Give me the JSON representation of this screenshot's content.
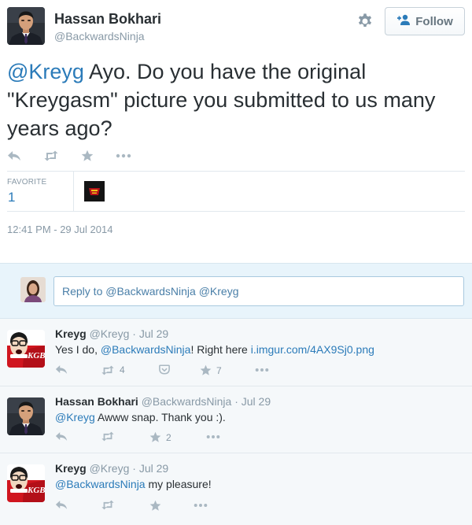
{
  "main_tweet": {
    "author_name": "Hassan Bokhari",
    "author_handle": "@BackwardsNinja",
    "follow_label": "Follow",
    "text_mention": "@Kreyg",
    "text_body": " Ayo. Do you have the original \"Kreygasm\" picture you submitted to us many years ago?",
    "favorite_label": "FAVORITE",
    "favorite_count": "1",
    "timestamp": "12:41 PM - 29 Jul 2014"
  },
  "reply_box": {
    "placeholder": "Reply to @BackwardsNinja @Kreyg"
  },
  "replies": [
    {
      "name": "Kreyg",
      "handle": "@Kreyg",
      "date": "Jul 29",
      "text_pre": "Yes I do, ",
      "mention": "@BackwardsNinja",
      "text_mid": "! Right here ",
      "link": "i.imgur.com/4AX9Sj0.png",
      "retweet_count": "4",
      "favorite_count": "7"
    },
    {
      "name": "Hassan Bokhari",
      "handle": "@BackwardsNinja",
      "date": "Jul 29",
      "mention": "@Kreyg",
      "text_rest": " Awww snap. Thank you :).",
      "favorite_count": "2"
    },
    {
      "name": "Kreyg",
      "handle": "@Kreyg",
      "date": "Jul 29",
      "mention": "@BackwardsNinja",
      "text_rest": " my pleasure!"
    }
  ],
  "colors": {
    "link": "#2b7bb9",
    "muted": "#8899a6",
    "text": "#292f33",
    "reply_bg": "#f5f8fa",
    "composer_bg": "#e8f4fb"
  },
  "icons": [
    "gear-icon",
    "follow-person-icon",
    "reply-icon",
    "retweet-icon",
    "favorite-star-icon",
    "more-dots-icon",
    "pocket-icon"
  ]
}
